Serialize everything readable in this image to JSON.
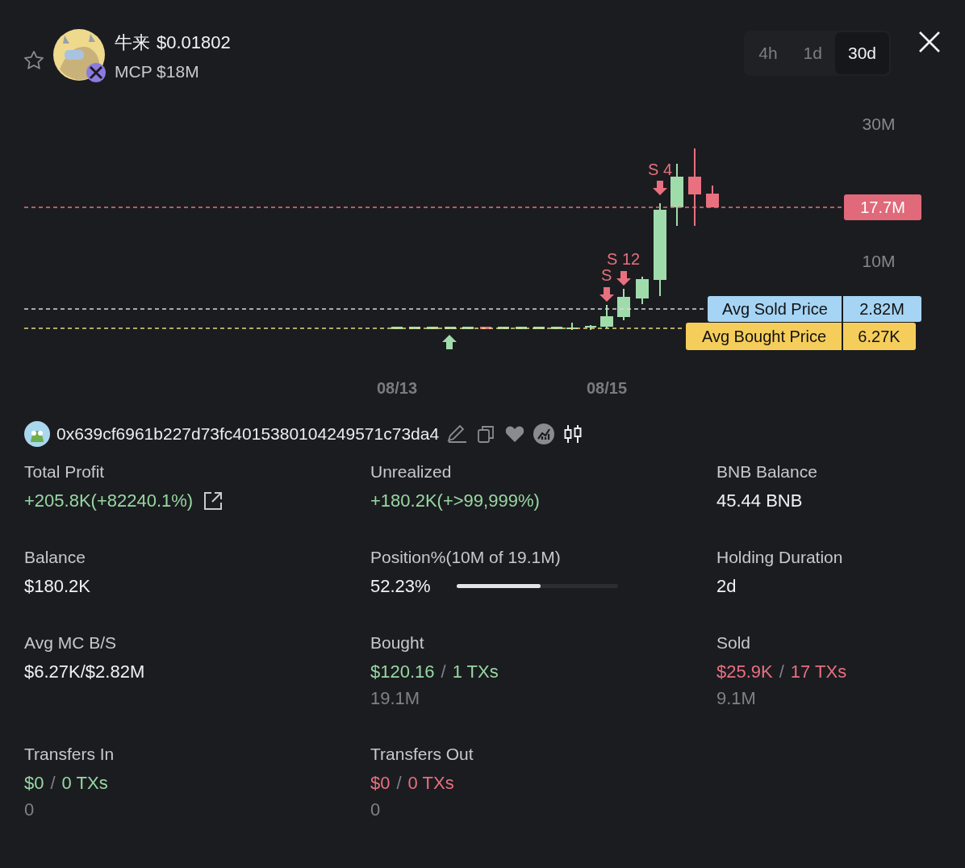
{
  "token": {
    "name": "牛来",
    "price": "$0.01802",
    "mcp": "MCP $18M",
    "favorite": false
  },
  "timeframes": [
    {
      "label": "4h",
      "selected": false
    },
    {
      "label": "1d",
      "selected": false
    },
    {
      "label": "30d",
      "selected": true
    }
  ],
  "chart": {
    "yticks": [
      "30M",
      "10M"
    ],
    "xticks": [
      "08/13",
      "08/15"
    ],
    "markers": [
      {
        "kind": "buy"
      },
      {
        "kind": "sell",
        "label": "S"
      },
      {
        "kind": "sell",
        "label": "S 12"
      },
      {
        "kind": "sell",
        "label": "S 4"
      }
    ],
    "price_lines": [
      {
        "kind": "current",
        "value": "17.7M"
      },
      {
        "kind": "sold",
        "label": "Avg Sold Price",
        "value": "2.82M"
      },
      {
        "kind": "bought",
        "label": "Avg Bought Price",
        "value": "6.27K"
      }
    ]
  },
  "wallet": {
    "address": "0x639cf6961b227d73fc4015380104249571c73da4"
  },
  "stats": [
    {
      "label": "Total Profit",
      "values": [
        {
          "text": "+205.8K(+82240.1%)",
          "color": "#98d8a2"
        }
      ],
      "link": true
    },
    {
      "label": "Unrealized",
      "values": [
        {
          "text": "+180.2K(+>99,999%)",
          "color": "#98d8a2"
        }
      ]
    },
    {
      "label": "BNB Balance",
      "values": [
        {
          "text": "45.44 BNB",
          "color": "#f1f1f3"
        }
      ]
    },
    {
      "label": "Balance",
      "values": [
        {
          "text": "$180.2K",
          "color": "#f1f1f3"
        }
      ]
    },
    {
      "label": "Position%(10M of 19.1M)",
      "values": [
        {
          "text": "52.23%",
          "color": "#f1f1f3"
        }
      ],
      "level": 0.52
    },
    {
      "label": "Holding Duration",
      "values": [
        {
          "text": "2d",
          "color": "#f1f1f3"
        }
      ]
    },
    {
      "label": "Avg MC B/S",
      "values": [
        {
          "text": "$6.27K/$2.82M",
          "color": "#f1f1f3"
        }
      ]
    },
    {
      "label": "Bought",
      "values": [
        {
          "text": "$120.16",
          "color": "#98d8a2"
        },
        {
          "text": "/",
          "color": "#7f8086"
        },
        {
          "text": "1 TXs",
          "color": "#98d8a2"
        }
      ],
      "sub": "19.1M"
    },
    {
      "label": "Sold",
      "values": [
        {
          "text": "$25.9K",
          "color": "#e8707f"
        },
        {
          "text": "/",
          "color": "#7f8086"
        },
        {
          "text": "17 TXs",
          "color": "#e8707f"
        }
      ],
      "sub": "9.1M"
    },
    {
      "label": "Transfers In",
      "values": [
        {
          "text": "$0",
          "color": "#98d8a2"
        },
        {
          "text": "/",
          "color": "#7f8086"
        },
        {
          "text": "0 TXs",
          "color": "#98d8a2"
        }
      ],
      "sub": "0"
    },
    {
      "label": "Transfers Out",
      "values": [
        {
          "text": "$0",
          "color": "#e8707f"
        },
        {
          "text": "/",
          "color": "#7f8086"
        },
        {
          "text": "0 TXs",
          "color": "#e8707f"
        }
      ],
      "sub": "0"
    }
  ]
}
